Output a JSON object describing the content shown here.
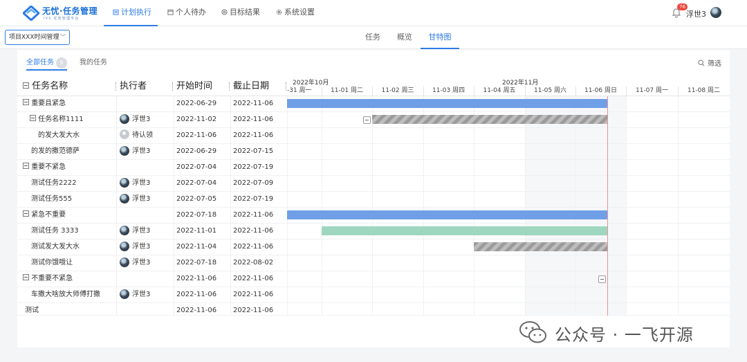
{
  "header": {
    "logo_title": "无忧·任务管理",
    "logo_subtitle": "IVS 任务管理平台",
    "nav": [
      {
        "label": "计划执行",
        "icon": "calendar-list-icon",
        "active": true
      },
      {
        "label": "个人待办",
        "icon": "calendar-icon",
        "active": false
      },
      {
        "label": "目标结果",
        "icon": "target-icon",
        "active": false
      },
      {
        "label": "系统设置",
        "icon": "gear-icon",
        "active": false
      }
    ],
    "notification_count": "76",
    "user_name": "浮世3"
  },
  "subbar": {
    "project_select": "项目XXX时间管理",
    "tabs": [
      {
        "label": "任务",
        "active": false
      },
      {
        "label": "概览",
        "active": false
      },
      {
        "label": "甘特图",
        "active": true
      }
    ]
  },
  "filter": {
    "all_tasks": "全部任务",
    "all_count": "9",
    "my_tasks": "我的任务",
    "filter_label": "筛选"
  },
  "table": {
    "headers": {
      "name": "任务名称",
      "owner": "执行者",
      "start": "开始时间",
      "end": "截止日期"
    },
    "months": [
      "2022年10月",
      "2022年11月"
    ],
    "days": [
      "-31 周一",
      "11-01 周二",
      "11-02 周三",
      "11-03 周四",
      "11-04 周五",
      "11-05 周六",
      "11-06 周日",
      "11-07 周一",
      "11-08 周二"
    ],
    "rows": [
      {
        "name": "重要且紧急",
        "owner": "",
        "start": "2022-06-29",
        "end": "2022-11-06"
      },
      {
        "name": "任务名称1111",
        "owner": "浮世3",
        "start": "2022-11-02",
        "end": "2022-11-06"
      },
      {
        "name": "的发大发大水",
        "owner": "待认领",
        "start": "2022-11-06",
        "end": "2022-11-06"
      },
      {
        "name": "的发的撒范德萨",
        "owner": "浮世3",
        "start": "2022-06-29",
        "end": "2022-07-15"
      },
      {
        "name": "重要不紧急",
        "owner": "",
        "start": "2022-07-04",
        "end": "2022-07-19"
      },
      {
        "name": "测试任务2222",
        "owner": "浮世3",
        "start": "2022-07-04",
        "end": "2022-07-09"
      },
      {
        "name": "测试任务555",
        "owner": "浮世3",
        "start": "2022-07-05",
        "end": "2022-07-19"
      },
      {
        "name": "紧急不重要",
        "owner": "",
        "start": "2022-07-18",
        "end": "2022-11-06"
      },
      {
        "name": "测试任务 3333",
        "owner": "浮世3",
        "start": "2022-11-01",
        "end": "2022-11-06"
      },
      {
        "name": "测试发大发大水",
        "owner": "浮世3",
        "start": "2022-11-04",
        "end": "2022-11-06"
      },
      {
        "name": "测试你饿哦让",
        "owner": "浮世3",
        "start": "2022-07-18",
        "end": "2022-08-02"
      },
      {
        "name": "不重要不紧急",
        "owner": "",
        "start": "2022-11-06",
        "end": "2022-11-06"
      },
      {
        "name": "车撒大啥放大师傅打撒",
        "owner": "浮世3",
        "start": "2022-11-06",
        "end": "2022-11-06"
      },
      {
        "name": "测试",
        "owner": "",
        "start": "2022-11-06",
        "end": "2022-11-06"
      }
    ]
  },
  "watermark": "公众号 · 一飞开源",
  "colors": {
    "accent": "#2d7be5",
    "bar_blue": "#6f9fe6",
    "bar_green": "#9ed6c0",
    "today_line": "#f08f8f"
  }
}
